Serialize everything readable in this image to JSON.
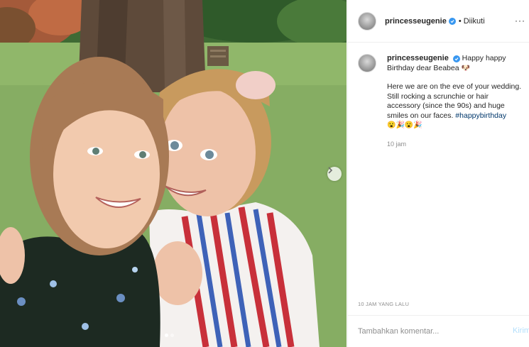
{
  "post": {
    "username": "princesseugenie",
    "follow_status": "Diikuti",
    "caption_line1": "Happy happy Birthday dear Beabea",
    "caption_line2": "Here we are on the eve of your wedding. Still rocking a scrunchie or hair accessory (since the 90s) and huge smiles on our faces.",
    "hashtag": "#happybirthday",
    "caption_emoji_1": "🐶",
    "hashtag_emojis": "😮🎉😮🎉",
    "comment_time": "10 jam",
    "post_date": "10 JAM YANG LALU",
    "comment_placeholder": "Tambahkan komentar...",
    "post_button": "Kirim",
    "verified_color": "#3897f0",
    "carousel": {
      "current": 1,
      "total": 2
    }
  }
}
